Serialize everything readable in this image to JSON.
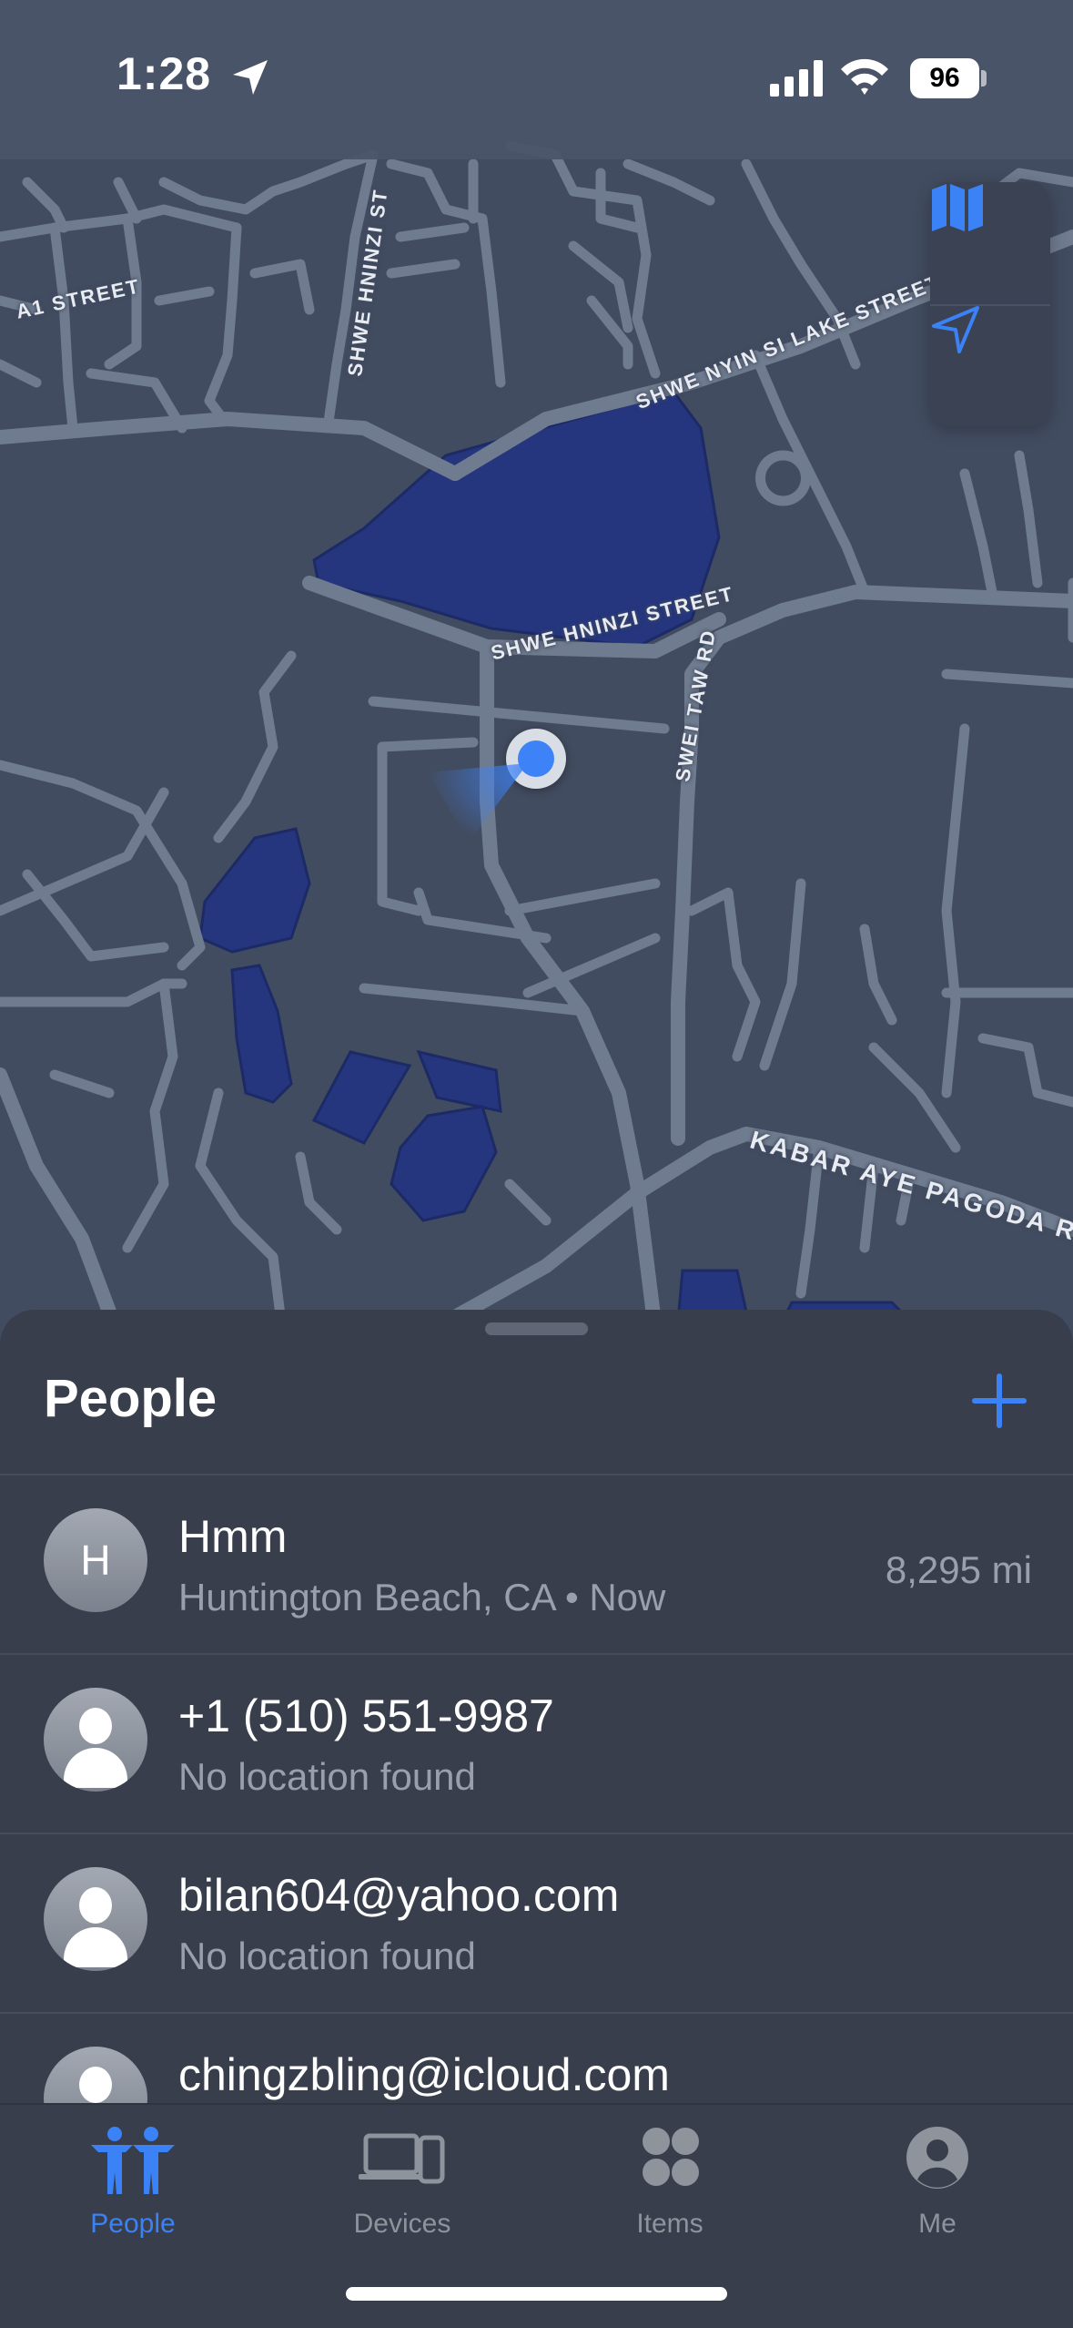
{
  "status_bar": {
    "time": "1:28",
    "battery": "96"
  },
  "map": {
    "street_labels": [
      "A1 STREET",
      "SHWE HNINZI ST",
      "SHWE NYIN SI LAKE STREET",
      "SHWE HNINZI STREET",
      "SWEI TAW RD",
      "KABAR AYE PAGODA RO"
    ],
    "controls": [
      "map-style",
      "locate"
    ]
  },
  "sheet": {
    "title": "People",
    "people": [
      {
        "name": "Hmm",
        "initial": "H",
        "subtitle": "Huntington Beach, CA • Now",
        "distance": "8,295 mi"
      },
      {
        "name": "+1 (510) 551-9987",
        "subtitle": "No location found"
      },
      {
        "name": "bilan604@yahoo.com",
        "subtitle": "No location found"
      },
      {
        "name": "chingzbling@icloud.com",
        "subtitle": ""
      }
    ]
  },
  "tabs": [
    {
      "label": "People",
      "icon": "people-icon",
      "active": true
    },
    {
      "label": "Devices",
      "icon": "devices-icon",
      "active": false
    },
    {
      "label": "Items",
      "icon": "items-icon",
      "active": false
    },
    {
      "label": "Me",
      "icon": "me-icon",
      "active": false
    }
  ],
  "colors": {
    "accent": "#3b82f6",
    "map_background": "#424c60",
    "road": "#6f7b8e",
    "water": "#25367e",
    "sheet": "#383e4b"
  }
}
